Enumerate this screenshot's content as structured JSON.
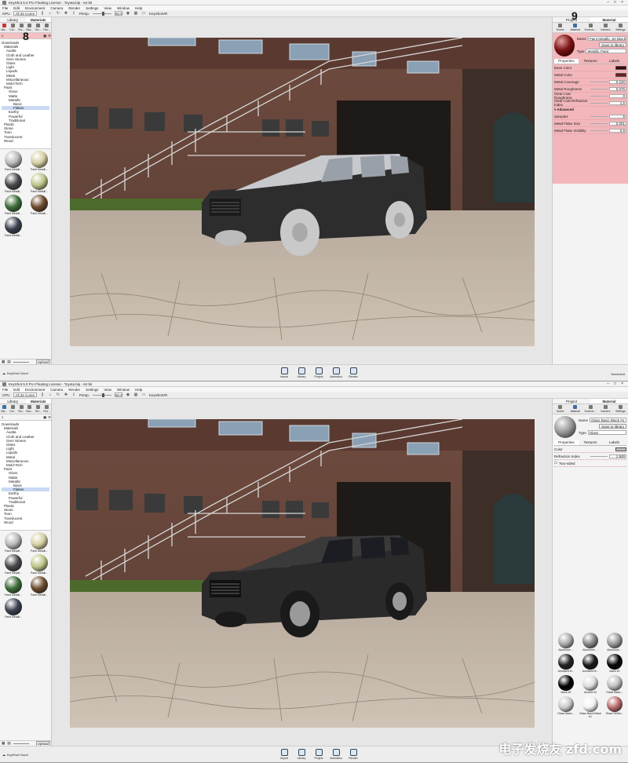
{
  "app": {
    "title": "KeyShot 5.0 Pro Floating License - Toyota.bip - 64 bit",
    "menu": [
      "File",
      "Edit",
      "Environment",
      "Camera",
      "Render",
      "Settings",
      "View",
      "Window",
      "Help"
    ],
    "cpu_label": "CPU",
    "cpu_value": "All 32 Cores",
    "persp_label": "Persp.",
    "fov_value": "50.0",
    "keyshotvr": "KeyShotVR"
  },
  "library": {
    "tabs": [
      "Library",
      "Materials"
    ],
    "icon_tabs": [
      "Ma...",
      "Col...",
      "Tex...",
      "Bac...",
      "Tex...",
      "Fav..."
    ],
    "tree": [
      "Materials",
      "Axalta",
      "Cloth and Leather",
      "Gem Stones",
      "Glass",
      "Light",
      "Liquids",
      "Metal",
      "Miscellaneous",
      "Mold-Tech",
      "Paint",
      "Gloss",
      "Matte",
      "Metallic",
      "Basic",
      "Flakes",
      "Earthy",
      "Powerful",
      "Traditional",
      "Plastic",
      "Stone",
      "Toon",
      "Translucent",
      "Wood"
    ],
    "tree_root": "Downloads",
    "selected_tree_item": "Flakes",
    "thumbs": [
      {
        "label": "Paint Metalli...",
        "color": "#b9b9b9"
      },
      {
        "label": "Paint Metalli...",
        "color": "#d6cfa3"
      },
      {
        "label": "Paint Metalli...",
        "color": "#4a4a4a"
      },
      {
        "label": "Paint Metalli...",
        "color": "#bfc58a"
      },
      {
        "label": "Paint Metalli...",
        "color": "#3f6e3b"
      },
      {
        "label": "Paint Metalli...",
        "color": "#6b4a2e"
      },
      {
        "label": "Paint Metalli...",
        "color": "#3c4250"
      }
    ],
    "cloud": "KeyShot Cloud",
    "zoom": "Upload"
  },
  "right": {
    "tabs": [
      "Project",
      "Material"
    ],
    "icon_tabs": [
      "Scene",
      "Material",
      "Environ...",
      "Camera",
      "Settings"
    ]
  },
  "material1": {
    "name_label": "Name",
    "name": "Paint Metallic Jet Black",
    "save_btn": "Save to library",
    "type_label": "Type",
    "type": "Metallic Paint",
    "subtabs": [
      "Properties",
      "Textures",
      "Labels"
    ],
    "props": [
      {
        "label": "Base Color",
        "kind": "swatch",
        "value": "#3a0a0a"
      },
      {
        "label": "Metal Color",
        "kind": "swatch",
        "value": "#6a1e1e"
      },
      {
        "label": "Metal Coverage",
        "kind": "value",
        "value": "0.226"
      },
      {
        "label": "Metal Roughness",
        "kind": "value",
        "value": "0.076"
      },
      {
        "label": "Clear-coat Roughness",
        "kind": "value",
        "value": "0"
      },
      {
        "label": "Clear-coat Refraction Index",
        "kind": "value",
        "value": "1.5"
      }
    ],
    "advanced_label": "Advanced",
    "advanced": [
      {
        "label": "Samples",
        "value": "9"
      },
      {
        "label": "Metal Flake Size",
        "value": "0.001"
      },
      {
        "label": "Metal Flake Visibility",
        "value": "0.8"
      }
    ]
  },
  "material2": {
    "name_label": "Name",
    "name": "Glass Basic Black #1",
    "save_btn": "Save to library",
    "type_label": "Type",
    "type": "Glass",
    "subtabs": [
      "Properties",
      "Textures",
      "Labels"
    ],
    "props": [
      {
        "label": "Color",
        "kind": "swatch",
        "value": "#bdbdbd"
      },
      {
        "label": "Refraction Index",
        "kind": "value",
        "value": "1.948"
      }
    ],
    "two_sided": "Two-sided",
    "library": [
      {
        "label": "Aluminum ...",
        "color": "#aaaaaa"
      },
      {
        "label": "Aluminum ...",
        "color": "#888888"
      },
      {
        "label": "Aluminum ...",
        "color": "#999999"
      },
      {
        "label": "Anodized B...",
        "color": "#222222"
      },
      {
        "label": "Anodized B...",
        "color": "#1a1a1a"
      },
      {
        "label": "black #2",
        "color": "#050505"
      },
      {
        "label": "black #2",
        "color": "#000000"
      },
      {
        "label": "chrome #2",
        "color": "#dcdcdc"
      },
      {
        "label": "Glass Basic...",
        "color": "#bfbfbf"
      },
      {
        "label": "Glass Basic...",
        "color": "#c9c9c9"
      },
      {
        "label": "Glass Basic Black #1",
        "color": "#f2f2f2"
      },
      {
        "label": "Glass Reflec...",
        "color": "#b86a6a"
      }
    ]
  },
  "bottom_bar": {
    "buttons": [
      "Import",
      "Library",
      "Project",
      "Animation",
      "Render"
    ],
    "cloud": "KeyShot Cloud",
    "screenshot": "Screenshot"
  },
  "annotations": {
    "search": "8",
    "material": "9"
  },
  "watermark": "电子发烧友 zfd.com",
  "colors": {
    "highlight": "#f3b7bb",
    "selection": "#c9d9f3"
  }
}
